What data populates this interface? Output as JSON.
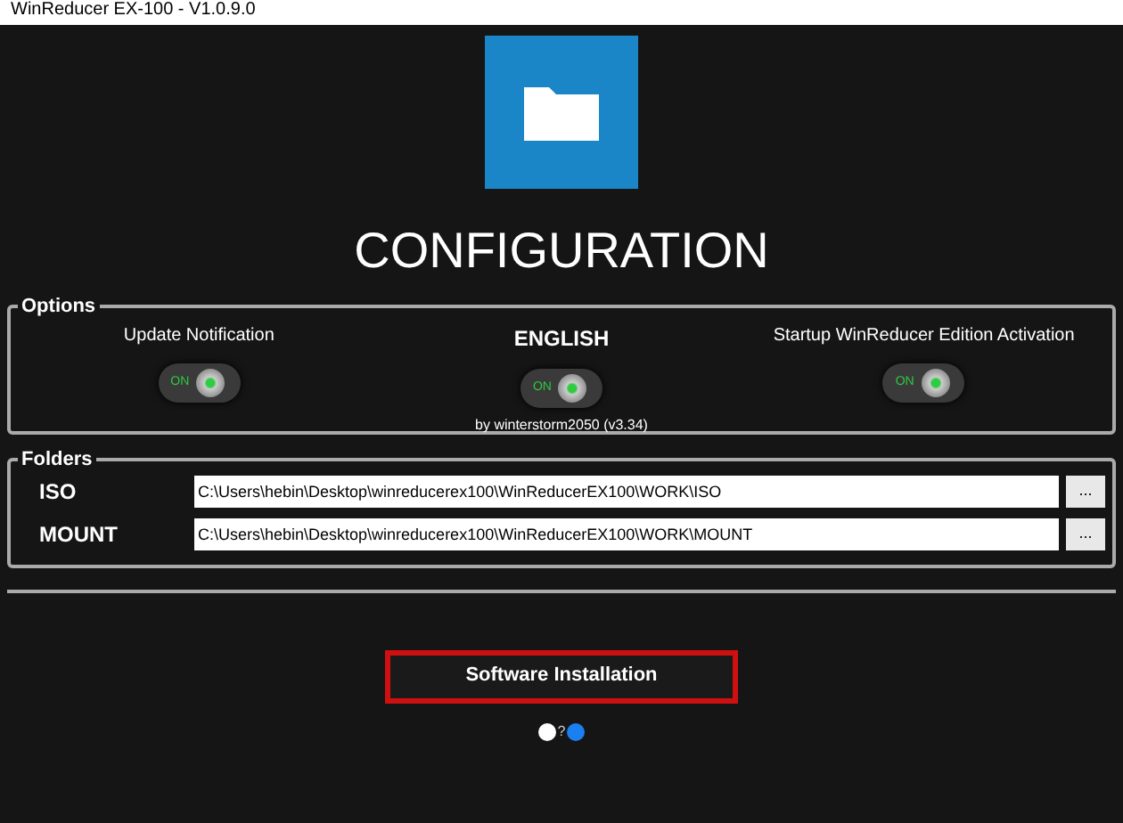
{
  "window": {
    "title": "WinReducer EX-100 - V1.0.9.0"
  },
  "heading": "CONFIGURATION",
  "options": {
    "label": "Options",
    "credit": "by winterstorm2050 (v3.34)",
    "items": [
      {
        "label": "Update Notification",
        "bold": false,
        "on": true,
        "switch_text": "ON"
      },
      {
        "label": "ENGLISH",
        "bold": true,
        "on": true,
        "switch_text": "ON"
      },
      {
        "label": "Startup WinReducer Edition Activation",
        "bold": false,
        "on": true,
        "switch_text": "ON"
      }
    ]
  },
  "folders": {
    "label": "Folders",
    "rows": [
      {
        "label": "ISO",
        "value": "C:\\Users\\hebin\\Desktop\\winreducerex100\\WinReducerEX100\\WORK\\ISO",
        "button": "..."
      },
      {
        "label": "MOUNT",
        "value": "C:\\Users\\hebin\\Desktop\\winreducerex100\\WinReducerEX100\\WORK\\MOUNT",
        "button": "..."
      }
    ]
  },
  "action": {
    "label": "Software Installation",
    "highlighted": true
  },
  "pager": {
    "separator": "?",
    "dots": [
      {
        "selected": false
      },
      {
        "selected": true
      }
    ]
  }
}
